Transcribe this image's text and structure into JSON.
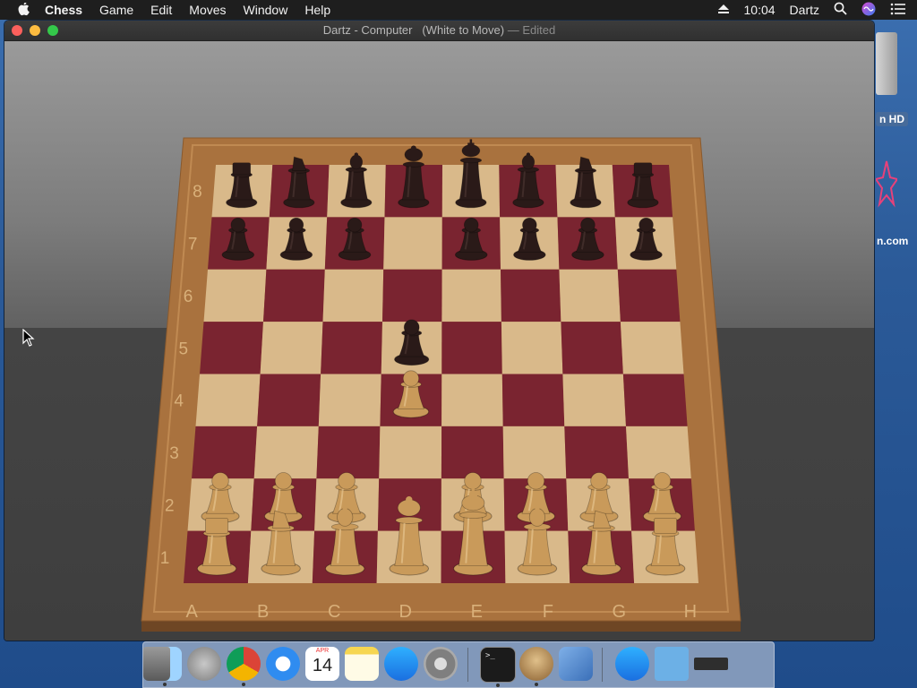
{
  "menubar": {
    "app_name": "Chess",
    "menus": [
      "Game",
      "Edit",
      "Moves",
      "Window",
      "Help"
    ],
    "clock": "10:04",
    "user": "Dartz"
  },
  "desktop": {
    "drive_label": "n HD",
    "item_label": "n.com"
  },
  "window": {
    "title": "Dartz - Computer",
    "status": "(White to Move)",
    "edited": "— Edited"
  },
  "board": {
    "files": [
      "A",
      "B",
      "C",
      "D",
      "E",
      "F",
      "G",
      "H"
    ],
    "ranks": [
      "1",
      "2",
      "3",
      "4",
      "5",
      "6",
      "7",
      "8"
    ],
    "position": [
      [
        "bR",
        "bN",
        "bB",
        "bQ",
        "bK",
        "bB",
        "bN",
        "bR"
      ],
      [
        "bP",
        "bP",
        "bP",
        "",
        "bP",
        "bP",
        "bP",
        "bP"
      ],
      [
        "",
        "",
        "",
        "",
        "",
        "",
        "",
        ""
      ],
      [
        "",
        "",
        "",
        "bP",
        "",
        "",
        "",
        ""
      ],
      [
        "",
        "",
        "",
        "wP",
        "",
        "",
        "",
        ""
      ],
      [
        "",
        "",
        "",
        "",
        "",
        "",
        "",
        ""
      ],
      [
        "wP",
        "wP",
        "wP",
        "",
        "wP",
        "wP",
        "wP",
        "wP"
      ],
      [
        "wR",
        "wN",
        "wB",
        "wQ",
        "wK",
        "wB",
        "wN",
        "wR"
      ]
    ],
    "colors": {
      "light_square": "#d9b98a",
      "dark_square": "#7a2430",
      "frame": "#a9723e",
      "white_piece": "#c99a5a",
      "black_piece": "#2a1a18"
    }
  },
  "dock": {
    "items": [
      {
        "name": "finder-icon",
        "running": true
      },
      {
        "name": "launchpad-icon",
        "running": false
      },
      {
        "name": "chrome-icon",
        "running": true
      },
      {
        "name": "safari-icon",
        "running": false
      },
      {
        "name": "calendar-icon",
        "running": false,
        "month": "APR",
        "day": "14"
      },
      {
        "name": "notes-icon",
        "running": false
      },
      {
        "name": "app-store-icon",
        "running": false
      },
      {
        "name": "system-preferences-icon",
        "running": false
      },
      {
        "name": "terminal-icon",
        "running": true
      },
      {
        "name": "chess-icon",
        "running": true
      },
      {
        "name": "preview-icon",
        "running": false
      },
      {
        "name": "app-store-folder-icon",
        "running": false
      },
      {
        "name": "folder-icon",
        "running": false
      },
      {
        "name": "drive-icon",
        "running": false
      },
      {
        "name": "trash-icon",
        "running": false
      }
    ]
  }
}
